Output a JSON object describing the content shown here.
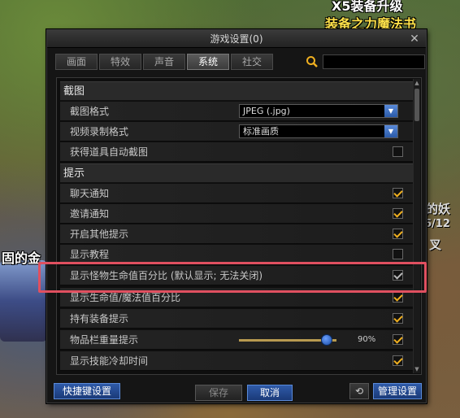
{
  "background": {
    "top_line1": "X5装备升级",
    "top_line2": "装备之力魔法书",
    "left_text": "固的金",
    "right_text1": "的妖",
    "right_text2": "6/12",
    "right_text3": "叉"
  },
  "window": {
    "title": "游戏设置(0)"
  },
  "tabs": [
    {
      "label": "画面"
    },
    {
      "label": "特效"
    },
    {
      "label": "声音"
    },
    {
      "label": "系统"
    },
    {
      "label": "社交"
    }
  ],
  "active_tab": "系统",
  "search": {
    "value": ""
  },
  "sections": {
    "screenshot": "截图",
    "tips": "提示"
  },
  "rows": {
    "screenshot_format": {
      "label": "截图格式",
      "value": "JPEG (.jpg)"
    },
    "video_format": {
      "label": "视频录制格式",
      "value": "标准画质"
    },
    "auto_screenshot": {
      "label": "获得道具自动截图",
      "checked": false
    },
    "chat_notify": {
      "label": "聊天通知",
      "checked": true
    },
    "invite_notify": {
      "label": "邀请通知",
      "checked": true
    },
    "other_tips": {
      "label": "开启其他提示",
      "checked": true
    },
    "show_tutorial": {
      "label": "显示教程",
      "checked": false
    },
    "monster_hp": {
      "label": "显示怪物生命值百分比 (默认显示; 无法关闭)",
      "checked": true
    },
    "hp_mp_percent": {
      "label": "显示生命值/魔法值百分比",
      "checked": true
    },
    "equipment_tips": {
      "label": "持有装备提示",
      "checked": true
    },
    "inventory_weight": {
      "label": "物品栏重量提示",
      "value": "90%",
      "level": 0.9,
      "checked": true
    },
    "skill_cooldown": {
      "label": "显示技能冷却时间",
      "checked": true
    }
  },
  "buttons": {
    "hotkey": "快捷键设置",
    "save": "保存",
    "cancel": "取消",
    "manage": "管理设置"
  },
  "colors": {
    "checkmark": "#f0b020",
    "highlight": "#e05060",
    "button_blue": "#2f5aa8"
  }
}
